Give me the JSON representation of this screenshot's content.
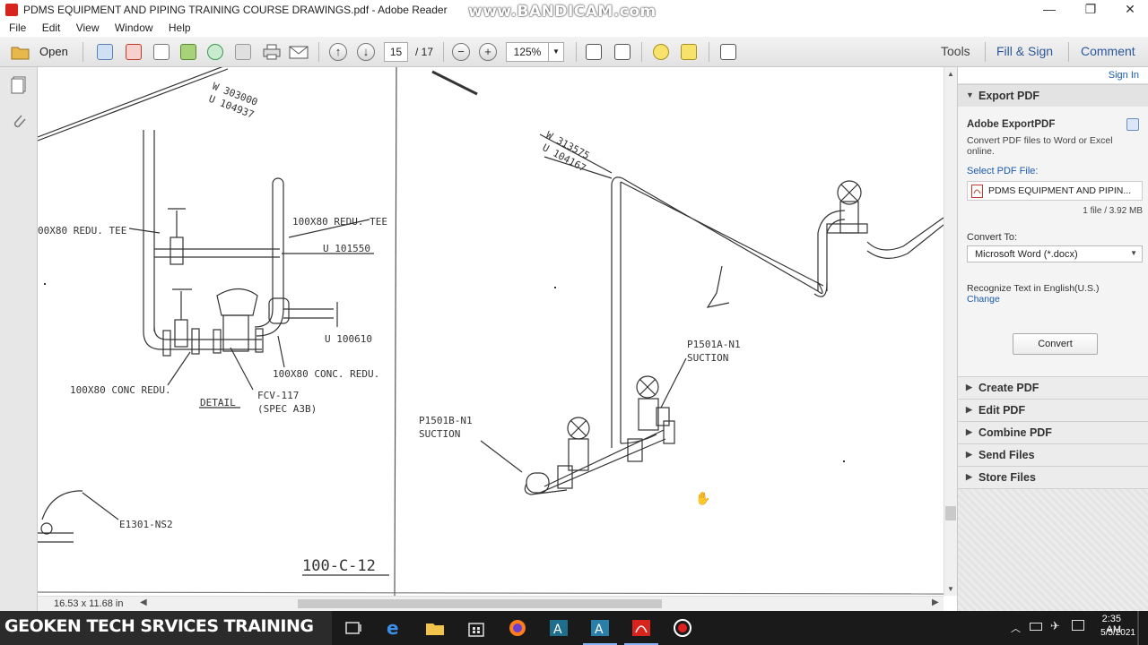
{
  "window": {
    "title": "PDMS EQUIPMENT AND PIPING TRAINING COURSE DRAWINGS.pdf - Adobe Reader",
    "watermark": "www.BANDICAM.com",
    "minimize": "—",
    "maximize": "❐",
    "close": "✕"
  },
  "menu": [
    "File",
    "Edit",
    "View",
    "Window",
    "Help"
  ],
  "toolbar": {
    "open_label": "Open",
    "page_current": "15",
    "page_total": "/ 17",
    "zoom": "125%",
    "tools_label": "Tools",
    "fill_sign_label": "Fill & Sign",
    "comment_label": "Comment"
  },
  "drawing": {
    "labels": [
      "W 303000",
      "U 104937",
      "00X80 REDU. TEE",
      "100X80 REDU. TEE",
      "U 101550",
      "U 100610",
      "100X80 CONC. REDU.",
      "100X80 CONC REDU.",
      "FCV-117",
      "(SPEC A3B)",
      "DETAIL",
      "E1301-NS2",
      "100-C-12",
      "W 313575",
      "U 104167",
      "P1501A-N1",
      "SUCTION",
      "P1501B-N1",
      "SUCTION"
    ]
  },
  "statusbar": {
    "page_size": "16.53 x 11.68 in"
  },
  "rightpane": {
    "sign_in": "Sign In",
    "export_header": "Export PDF",
    "adobe_export_title": "Adobe ExportPDF",
    "adobe_export_desc": "Convert PDF files to Word or Excel online.",
    "select_pdf_label": "Select PDF File:",
    "selected_file": "PDMS EQUIPMENT AND PIPIN...",
    "file_info": "1 file / 3.92 MB",
    "convert_to_label": "Convert To:",
    "convert_to_value": "Microsoft Word (*.docx)",
    "recognize_text": "Recognize Text in English(U.S.)",
    "change_link": "Change",
    "convert_button": "Convert",
    "sections": [
      "Create PDF",
      "Edit PDF",
      "Combine PDF",
      "Send Files",
      "Store Files"
    ]
  },
  "taskbar": {
    "brand": "GEOKEN TECH SRVICES TRAINING",
    "time": "2:35 AM",
    "date": "5/5/2021"
  },
  "colors": {
    "accent_blue": "#2b579a",
    "link_blue": "#1a5bab",
    "taskbar": "#1a1a1a",
    "pdf_red": "#d7241c"
  }
}
